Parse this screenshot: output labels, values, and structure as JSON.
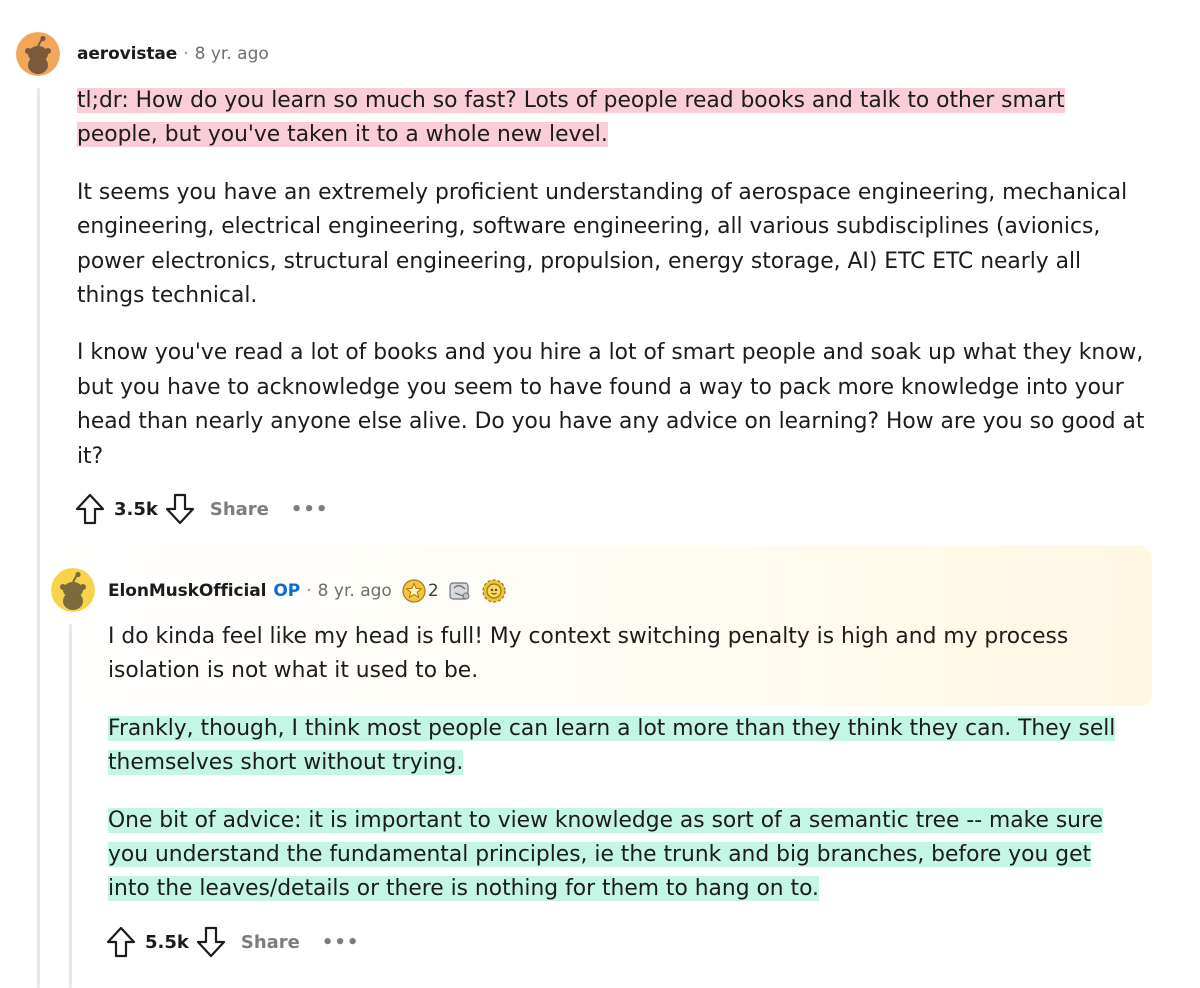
{
  "comments": [
    {
      "author": "aerovistae",
      "separator": "·",
      "time": "8 yr. ago",
      "paragraphs": {
        "p1": "tl;dr: How do you learn so much so fast? Lots of people read books and talk to other smart people, but you've taken it to a whole new level.",
        "p2": "It seems you have an extremely proficient understanding of aerospace engineering, mechanical engineering, electrical engineering, software engineering, all various subdisciplines (avionics, power electronics, structural engineering, propulsion, energy storage, AI) ETC ETC nearly all things technical.",
        "p3": "I know you've read a lot of books and you hire a lot of smart people and soak up what they know, but you have to acknowledge you seem to have found a way to pack more knowledge into your head than nearly anyone else alive. Do you have any advice on learning? How are you so good at it?"
      },
      "score": "3.5k",
      "share_label": "Share",
      "more_label": "•••",
      "avatar_color": "#f2a65a"
    },
    {
      "author": "ElonMuskOfficial",
      "op_badge": "OP",
      "separator": "·",
      "time": "8 yr. ago",
      "award_count": "2",
      "paragraphs": {
        "p1": "I do kinda feel like my head is full! My context switching penalty is high and my process isolation is not what it used to be.",
        "p2": "Frankly, though, I think most people can learn a lot more than they think they can. They sell themselves short without trying.",
        "p3": "One bit of advice: it is important to view knowledge as sort of a semantic tree -- make sure you understand the fundamental principles, ie the trunk and big branches, before you get into the leaves/details or there is nothing for them to hang on to."
      },
      "score": "5.5k",
      "share_label": "Share",
      "more_label": "•••",
      "avatar_color": "#f6d34a"
    }
  ],
  "colors": {
    "highlight_pink": "#fbcdd8",
    "highlight_mint": "#c4f6e6",
    "op_blue": "#0a6cd4"
  },
  "icons": [
    "snoo-avatar-icon",
    "upvote-icon",
    "downvote-icon",
    "more-options-icon",
    "gold-star-award-icon",
    "silver-award-icon",
    "gear-award-icon"
  ]
}
